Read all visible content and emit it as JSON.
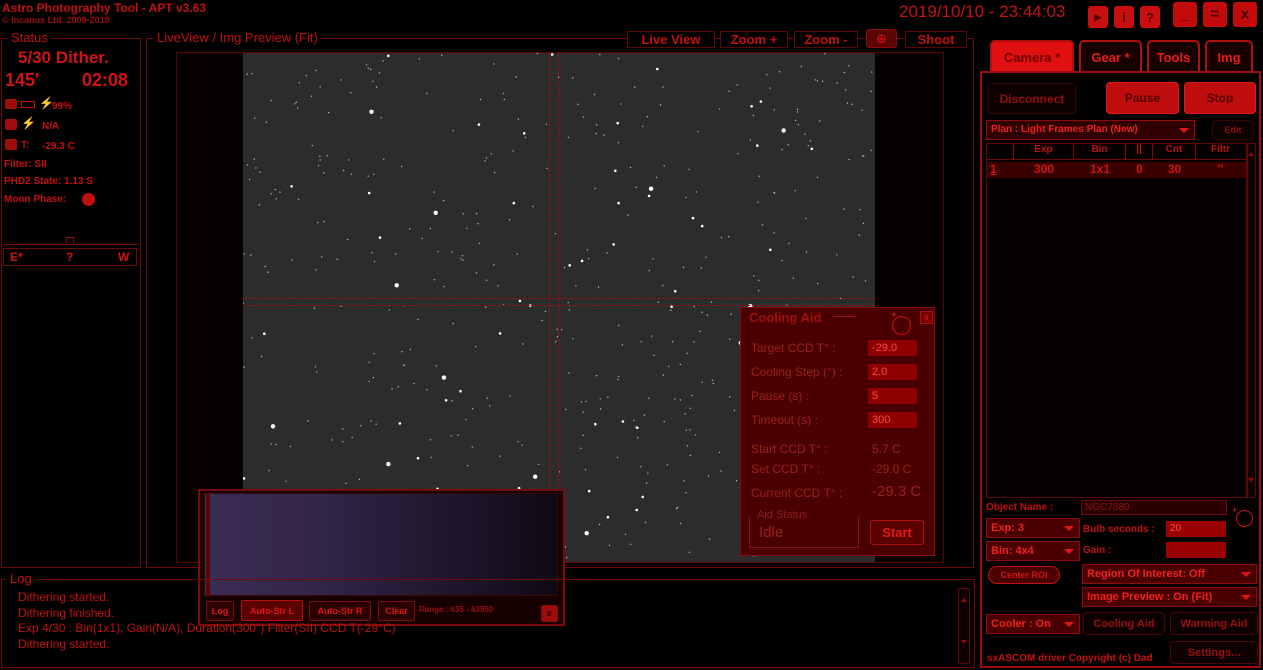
{
  "app": {
    "title": "Astro Photography Tool  -  APT v3.63",
    "copyright": "© Incanus Ltd. 2009-2019",
    "datetime": "2019/10/10 - 23:44:03"
  },
  "title_buttons": [
    "▶",
    "i",
    "?"
  ],
  "window_buttons": {
    "minimize": "_",
    "maximize": "=",
    "close": "x"
  },
  "status": {
    "group_title": "Status",
    "dither": "5/30 Dither.",
    "angle": "145'",
    "time": "02:08",
    "battery": "99%",
    "power": "N/A",
    "temp_label": "T:",
    "temp": "-29.3 C",
    "filter": "Filter: SII",
    "phd2": "PHD2 State: 1.13 S",
    "moon": "Moon Phase:",
    "compass": {
      "e": "E*",
      "q": "?",
      "w": "W"
    }
  },
  "liveview": {
    "group_title": "LiveView / Img Preview (Fit)",
    "buttons": [
      "Live View",
      "Zoom +",
      "Zoom -",
      "⊕",
      "Shoot"
    ]
  },
  "tabs": [
    "Camera *",
    "Gear *",
    "Tools",
    "Img"
  ],
  "camera": {
    "disconnect": "Disconnect",
    "pause": "Pause",
    "stop": "Stop",
    "plan": "Plan : Light Frames Plan (New)",
    "edit": "Edit",
    "table": {
      "headers": [
        "",
        "Exp",
        "Bin",
        "||",
        "Cnt",
        "Filtr"
      ],
      "rows": [
        [
          "1",
          "300",
          "1x1",
          "0",
          "30",
          "\""
        ]
      ]
    },
    "object_name_label": "Object Name :",
    "object_name": "NGC7380",
    "exp": "Exp: 3",
    "bulb_label": "Bulb seconds :",
    "bulb": "20",
    "bin": "Bin: 4x4",
    "gain_label": "Gain :",
    "gain": "",
    "center_roi": "Center ROI",
    "roi": "Region Of Interest: Off",
    "preview": "Image Preview : On (Fit)",
    "cooler": "Cooler : On",
    "cooling_aid": "Cooling Aid",
    "warming_aid": "Warming Aid",
    "driver": "sxASCOM driver Copyright (c) Dad",
    "settings": "Settings..."
  },
  "cooling_aid": {
    "title": "Cooling Aid",
    "close": "x",
    "target_label": "Target CCD T° :",
    "target": "-29.0",
    "step_label": "Cooling Step (°) :",
    "step": "2.0",
    "pause_label": "Pause (s) :",
    "pause": "5",
    "timeout_label": "Timeout (s) :",
    "timeout": "300",
    "start_label": "Start CCD T° :",
    "start_val": "5.7 C",
    "set_label": "Set CCD T° :",
    "set_val": "-29.0 C",
    "current_label": "Current CCD T° :",
    "current_val": "-29.3 C",
    "aid_status_label": "Aid Status",
    "aid_status": "Idle",
    "start_button": "Start"
  },
  "histogram": {
    "buttons": [
      "Log",
      "Auto-Str L",
      "Auto-Str R",
      "Clear"
    ],
    "range": "Range : 635 - 63950",
    "expand": "»"
  },
  "log": {
    "group_title": "Log",
    "lines": [
      "Dithering started.",
      "Dithering finished.",
      "Exp 4/30 : Bin(1x1), Gain(N/A), Duration(300\") Filter(SII) CCD T(-29°C)",
      "Dithering started."
    ]
  },
  "colors": {
    "accent": "#e01010",
    "dark": "#3a0202",
    "field": "#8e0000"
  }
}
